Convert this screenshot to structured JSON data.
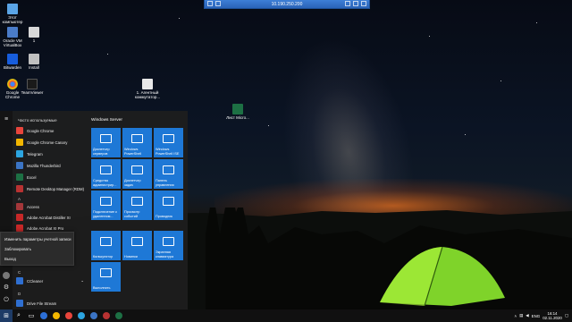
{
  "remote_bar": {
    "title": "10.190.250.200"
  },
  "desktop_icons": [
    {
      "label": "Этот компьютер",
      "icon": "computer-icon"
    },
    {
      "label": "Oracle VM VirtualBox",
      "icon": "virtualbox-icon"
    },
    {
      "label": "1",
      "icon": "folder-icon"
    },
    {
      "label": "Bitwarden",
      "icon": "bitwarden-icon"
    },
    {
      "label": "Install",
      "icon": "install-icon"
    },
    {
      "label": "Google Chrome",
      "icon": "chrome-icon"
    },
    {
      "label": "TeamViewer",
      "icon": "teamviewer-icon"
    },
    {
      "label": "1. Агентный коммутатор...",
      "icon": "document-icon"
    },
    {
      "label": "Лист Micro...",
      "icon": "excel-icon"
    }
  ],
  "start_menu": {
    "apps_header": "Часто используемые",
    "apps": [
      {
        "label": "Google Chrome",
        "color": "#e8453c"
      },
      {
        "label": "Google Chrome Canary",
        "color": "#f2b600"
      },
      {
        "label": "Telegram",
        "color": "#2ca5e0"
      },
      {
        "label": "Mozilla Thunderbird",
        "color": "#3b74c4"
      },
      {
        "label": "Excel",
        "color": "#1d7044"
      },
      {
        "label": "Remote Desktop Manager (RDM)",
        "color": "#b83232"
      }
    ],
    "letter_a": "A",
    "a_apps": [
      {
        "label": "Access",
        "color": "#a4373a"
      },
      {
        "label": "Adobe Acrobat Distiller XI",
        "color": "#c62828"
      },
      {
        "label": "Adobe Acrobat XI Pro",
        "color": "#c62828"
      }
    ],
    "letter_c": "C",
    "c_apps": [
      {
        "label": "CCleaner",
        "color": "#2f6fd1"
      }
    ],
    "letter_d": "D",
    "d_apps": [
      {
        "label": "Drive File Stream",
        "color": "#2f6fd1"
      }
    ],
    "account_popup": [
      "Изменить параметры учетной записи",
      "Заблокировать",
      "Выход"
    ],
    "tiles_group": "Windows Server",
    "tiles": [
      {
        "label": "Диспетчер серверов"
      },
      {
        "label": "Windows PowerShell"
      },
      {
        "label": "Windows PowerShell ISE"
      },
      {
        "label": "Средства администрир..."
      },
      {
        "label": "Диспетчер задач"
      },
      {
        "label": "Панель управления"
      },
      {
        "label": "Подключение к удаленном..."
      },
      {
        "label": "Просмотр событий"
      },
      {
        "label": "Проводник"
      },
      {
        "label": "Калькулятор"
      },
      {
        "label": "Новинки"
      },
      {
        "label": "Экранная клавиатура"
      },
      {
        "label": "Выполнить"
      }
    ]
  },
  "taskbar": {
    "language": "ENG",
    "time": "16:14",
    "date": "02.11.2020"
  },
  "colors": {
    "tile": "#1e78d6",
    "start_bg": "#1e1e1e",
    "taskbar": "#101010"
  }
}
